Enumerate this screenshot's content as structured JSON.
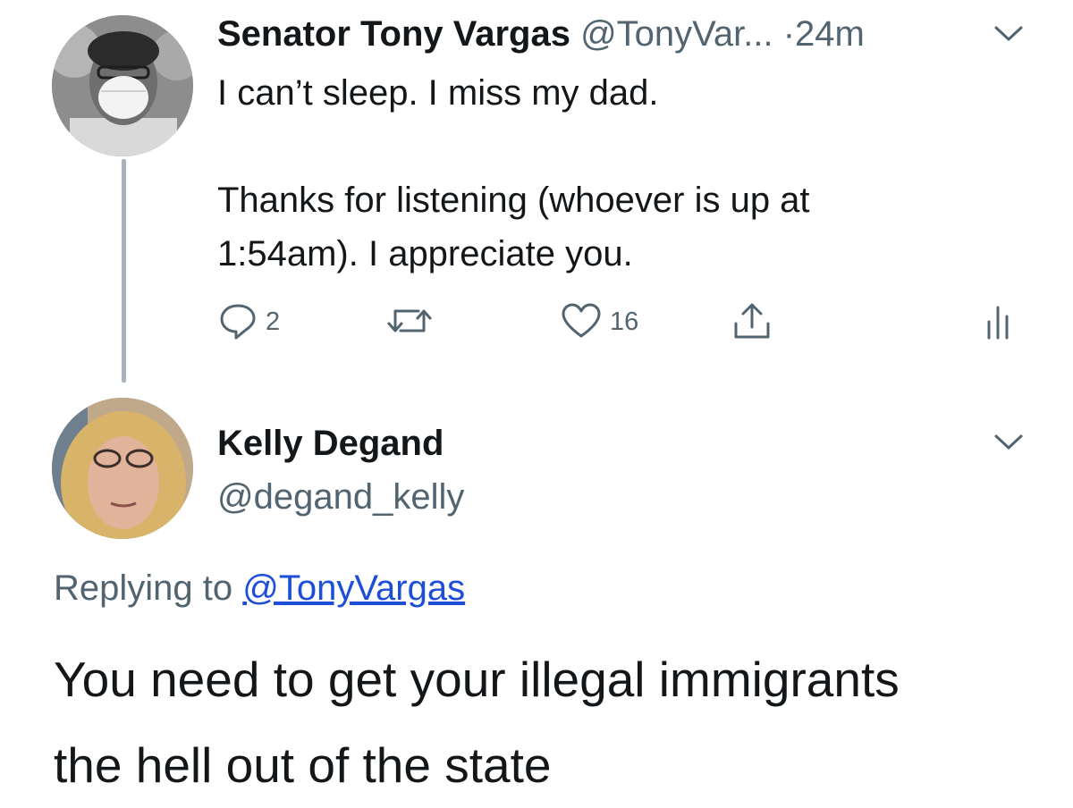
{
  "tweet": {
    "author_name": "Senator Tony Vargas",
    "author_handle": "@TonyVar...",
    "separator": "·",
    "time": "24m",
    "text_line1": "I can’t sleep. I miss my dad.",
    "text_line2": "Thanks for listening (whoever is up at",
    "text_line3": "1:54am). I appreciate you.",
    "reply_count": "2",
    "like_count": "16",
    "icons": [
      "reply-icon",
      "retweet-icon",
      "like-icon",
      "share-icon",
      "analytics-icon",
      "chevron-down-icon"
    ]
  },
  "reply": {
    "author_name": "Kelly Degand",
    "author_handle": "@degand_kelly",
    "replying_prefix": "Replying to",
    "replying_to": "@TonyVargas",
    "text_line1": "You need to get your illegal immigrants",
    "text_line2": "the hell out of the state"
  },
  "colors": {
    "text": "#14171a",
    "secondary": "#536471",
    "link": "#1d4ed8",
    "thread_line": "#a8b3bd"
  }
}
